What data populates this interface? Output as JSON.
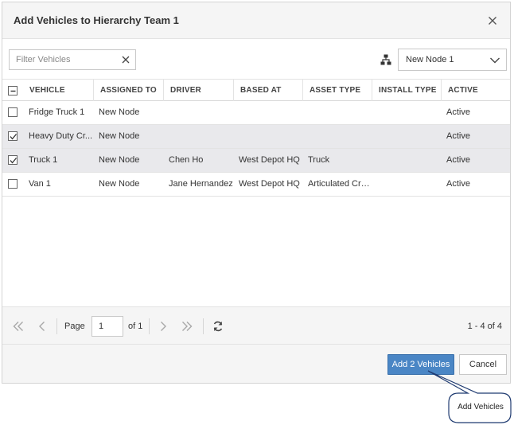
{
  "dialog": {
    "title": "Add Vehicles to Hierarchy Team 1"
  },
  "toolbar": {
    "filter_placeholder": "Filter Vehicles",
    "filter_value": "",
    "node_select_value": "New Node 1"
  },
  "grid": {
    "columns": [
      "VEHICLE",
      "ASSIGNED TO",
      "DRIVER",
      "BASED AT",
      "ASSET TYPE",
      "INSTALL TYPE",
      "ACTIVE"
    ],
    "header_checkbox_state": "indeterminate",
    "rows": [
      {
        "checked": false,
        "vehicle": "Fridge Truck 1",
        "assigned_to": "New Node",
        "driver": "",
        "based_at": "",
        "asset_type": "",
        "install_type": "",
        "active": "Active"
      },
      {
        "checked": true,
        "vehicle": "Heavy Duty Cr...",
        "assigned_to": "New Node",
        "driver": "",
        "based_at": "",
        "asset_type": "",
        "install_type": "",
        "active": "Active"
      },
      {
        "checked": true,
        "vehicle": "Truck 1",
        "assigned_to": "New Node",
        "driver": "Chen Ho",
        "based_at": "West Depot HQ",
        "asset_type": "Truck",
        "install_type": "",
        "active": "Active"
      },
      {
        "checked": false,
        "vehicle": "Van 1",
        "assigned_to": "New Node",
        "driver": "Jane Hernandez",
        "based_at": "West Depot HQ",
        "asset_type": "Articulated Crane",
        "install_type": "",
        "active": "Active"
      }
    ]
  },
  "pager": {
    "page_label": "Page",
    "page_value": "1",
    "of_label": "of 1",
    "count_label": "1 - 4 of 4"
  },
  "footer": {
    "primary_label": "Add 2 Vehicles",
    "cancel_label": "Cancel"
  },
  "callout": {
    "text": "Add Vehicles"
  },
  "colors": {
    "primary": "#4a86c5",
    "selected_row": "#e9e9ec",
    "header_bg": "#f5f5f5"
  }
}
